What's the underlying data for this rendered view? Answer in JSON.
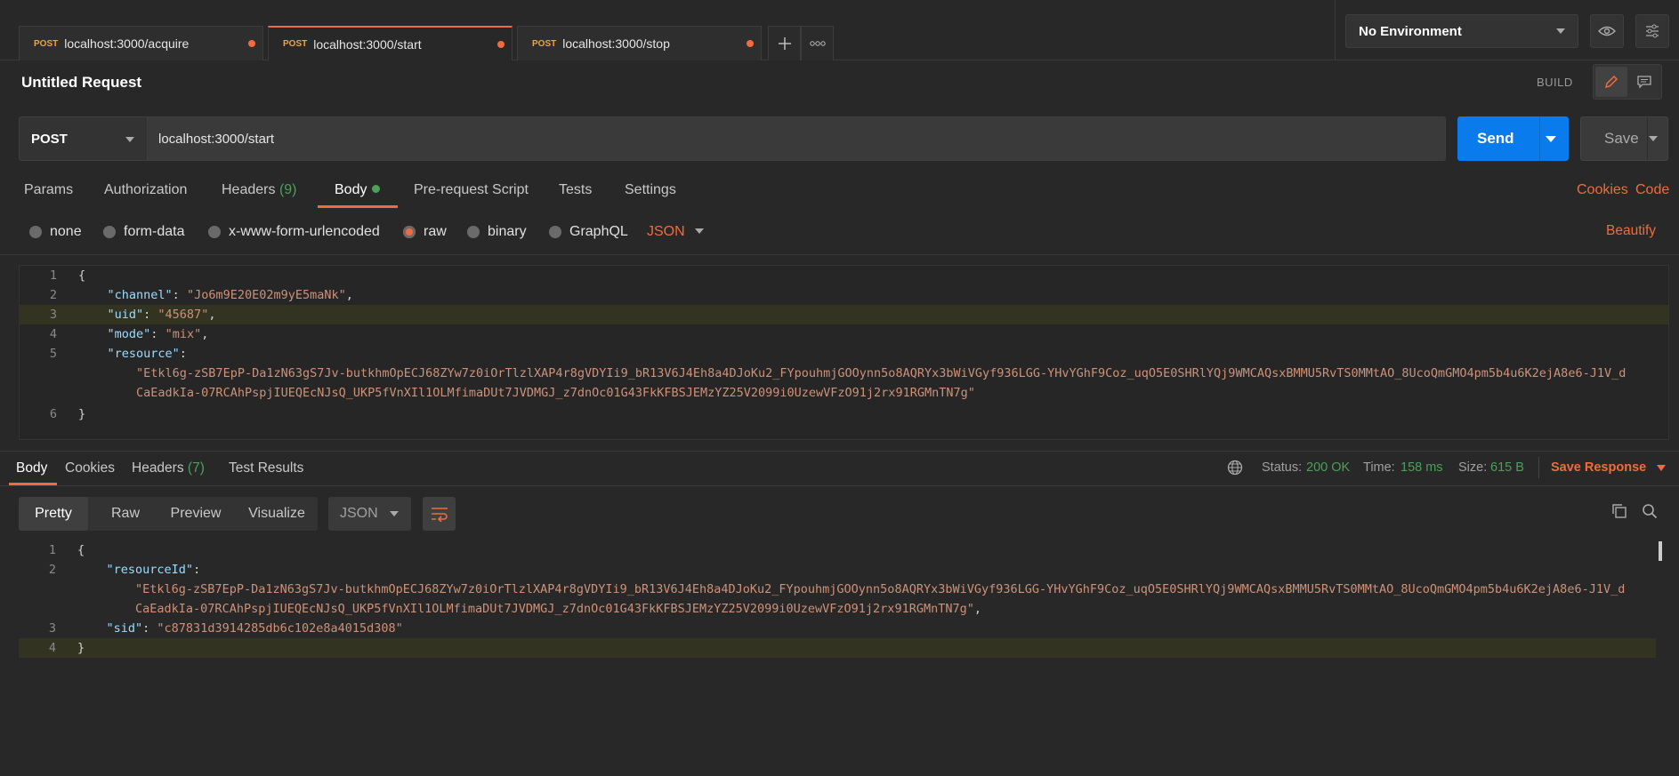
{
  "tabs": [
    {
      "method": "POST",
      "url": "localhost:3000/acquire"
    },
    {
      "method": "POST",
      "url": "localhost:3000/start"
    },
    {
      "method": "POST",
      "url": "localhost:3000/stop"
    }
  ],
  "environment": {
    "selected": "No Environment"
  },
  "request": {
    "name": "Untitled Request",
    "mode_label": "BUILD",
    "method": "POST",
    "url": "localhost:3000/start",
    "send_label": "Send",
    "save_label": "Save"
  },
  "request_tabs": {
    "params": "Params",
    "authorization": "Authorization",
    "headers": "Headers",
    "headers_count": "(9)",
    "body": "Body",
    "prerequest": "Pre-request Script",
    "tests": "Tests",
    "settings": "Settings",
    "cookies": "Cookies",
    "code": "Code"
  },
  "body_options": {
    "none": "none",
    "form_data": "form-data",
    "urlencoded": "x-www-form-urlencoded",
    "raw": "raw",
    "binary": "binary",
    "graphql": "GraphQL",
    "raw_type": "JSON",
    "beautify": "Beautify"
  },
  "request_body": {
    "l1": "{",
    "channel_key": "\"channel\"",
    "channel_val": "\"Jo6m9E20E02m9yE5maNk\"",
    "uid_key": "\"uid\"",
    "uid_val": "\"45687\"",
    "mode_key": "\"mode\"",
    "mode_val": "\"mix\"",
    "resource_key": "\"resource\"",
    "resource_val_1": "\"Etkl6g-zSB7EpP-Da1zN63gS7Jv-butkhmOpECJ68ZYw7z0iOrTlzlXAP4r8gVDYIi9_bR13V6J4Eh8a4DJoKu2_FYpouhmjGOOynn5o8AQRYx3bWiVGyf936LGG-YHvYGhF9Coz_uqO5E0SHRlYQj9WMCAQsxBMMU5RvTS0MMtAO_8UcoQmGMO4pm5b4u6K2ejA8e6-J1V_d",
    "resource_val_2": "CaEadkIa-07RCAhPspjIUEQEcNJsQ_UKP5fVnXIl1OLMfimaDUt7JVDMGJ_z7dnOc01G43FkKFBSJEMzYZ25V2099i0UzewVFzO91j2rx91RGMnTN7g\"",
    "l_end": "}"
  },
  "response_tabs": {
    "body": "Body",
    "cookies": "Cookies",
    "headers": "Headers",
    "headers_count": "(7)",
    "test_results": "Test Results"
  },
  "response_status": {
    "status_label": "Status:",
    "status": "200 OK",
    "time_label": "Time:",
    "time": "158 ms",
    "size_label": "Size:",
    "size": "615 B",
    "save_response": "Save Response"
  },
  "response_view": {
    "pretty": "Pretty",
    "raw": "Raw",
    "preview": "Preview",
    "visualize": "Visualize",
    "format": "JSON"
  },
  "response_body": {
    "l1": "{",
    "resource_id_key": "\"resourceId\"",
    "resource_id_val_1": "\"Etkl6g-zSB7EpP-Da1zN63gS7Jv-butkhmOpECJ68ZYw7z0iOrTlzlXAP4r8gVDYIi9_bR13V6J4Eh8a4DJoKu2_FYpouhmjGOOynn5o8AQRYx3bWiVGyf936LGG-YHvYGhF9Coz_uqO5E0SHRlYQj9WMCAQsxBMMU5RvTS0MMtAO_8UcoQmGMO4pm5b4u6K2ejA8e6-J1V_d",
    "resource_id_val_2": "CaEadkIa-07RCAhPspjIUEQEcNJsQ_UKP5fVnXIl1OLMfimaDUt7JVDMGJ_z7dnOc01G43FkKFBSJEMzYZ25V2099i0UzewVFzO91j2rx91RGMnTN7g\"",
    "sid_key": "\"sid\"",
    "sid_val": "\"c87831d3914285db6c102e8a4015d308\"",
    "l_end": "}"
  },
  "colors": {
    "accent": "#f26b3a",
    "send": "#097bed",
    "success": "#4ba05a"
  }
}
